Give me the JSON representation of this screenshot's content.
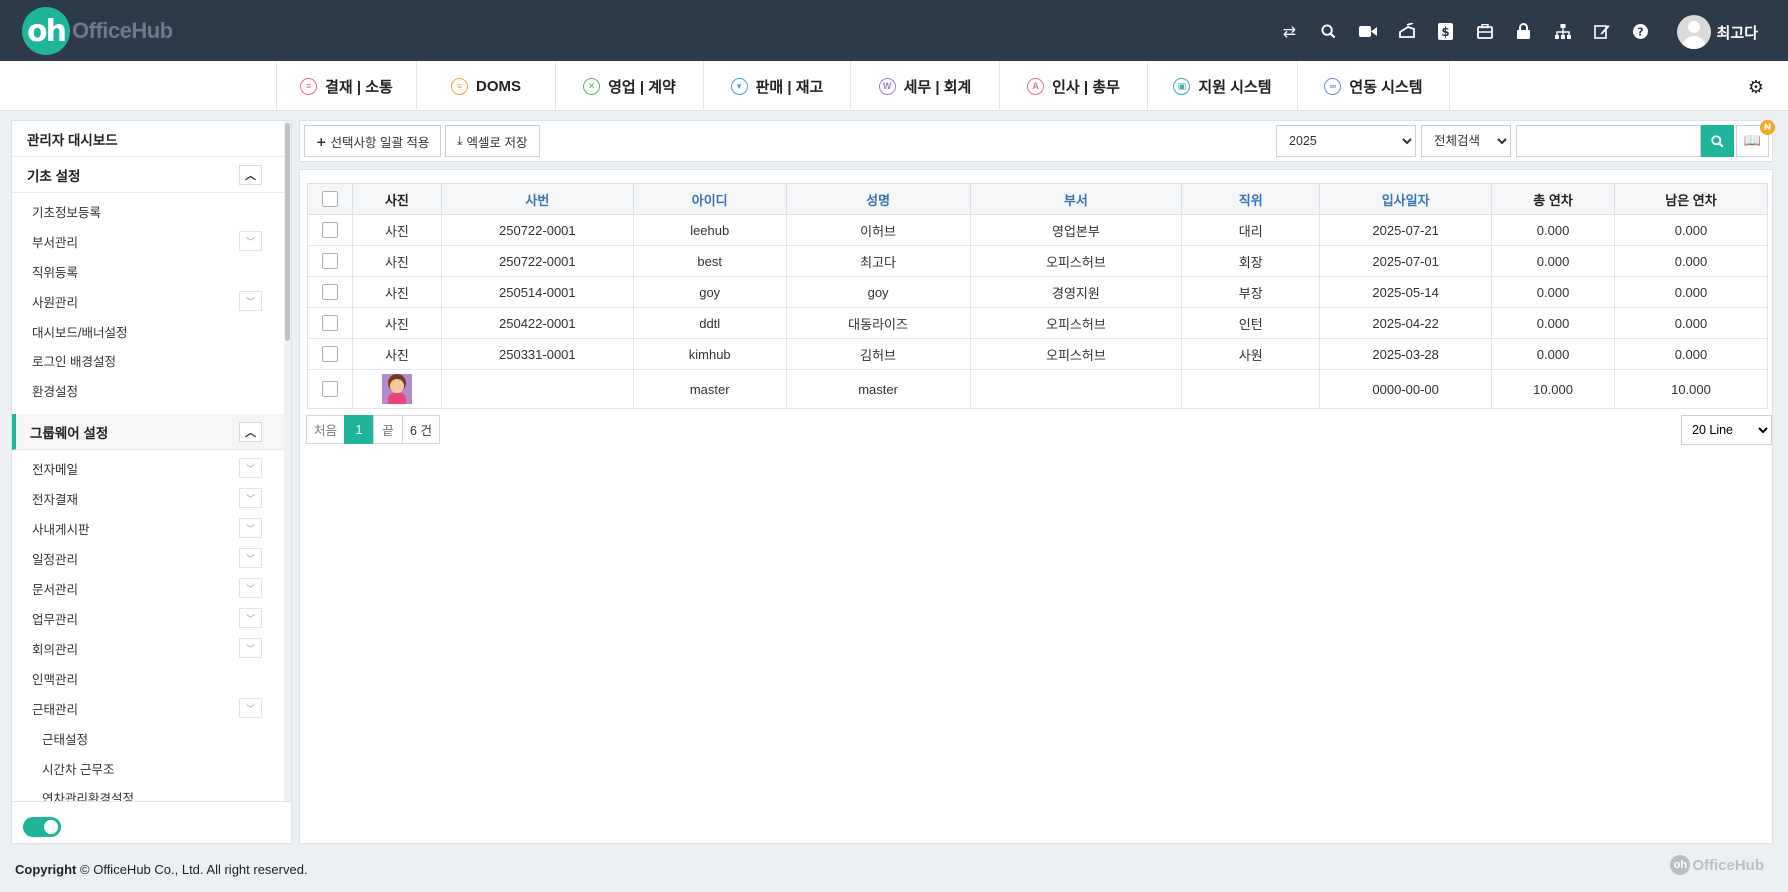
{
  "brand": {
    "mark": "oh",
    "name": "OfficeHub"
  },
  "top_icons": [
    "swap-icon",
    "search-icon",
    "video-icon",
    "fax-icon",
    "dollar-icon",
    "briefcase-icon",
    "lock-icon",
    "sitemap-icon",
    "edit-icon",
    "help-icon"
  ],
  "user": {
    "name": "최고다"
  },
  "nav": [
    {
      "label": "결재 | 소통",
      "icon": "approval-icon",
      "color": "#e86a7a"
    },
    {
      "label": "DOMS",
      "icon": "doms-icon",
      "color": "#f0a24a"
    },
    {
      "label": "영업 | 계약",
      "icon": "sales-icon",
      "color": "#5cb85c"
    },
    {
      "label": "판매 | 재고",
      "icon": "cart-icon",
      "color": "#4a9fd8"
    },
    {
      "label": "세무 | 회계",
      "icon": "won-icon",
      "color": "#9b7fd1"
    },
    {
      "label": "인사 | 총무",
      "icon": "hr-icon",
      "color": "#e86aa0"
    },
    {
      "label": "지원 시스템",
      "icon": "support-icon",
      "color": "#3ab0b0"
    },
    {
      "label": "연동 시스템",
      "icon": "link-icon",
      "color": "#6a8ad8"
    }
  ],
  "sidebar": {
    "dashboard": "관리자 대시보드",
    "basic_title": "기초 설정",
    "basic_items": [
      {
        "label": "기초정보등록",
        "expand": false
      },
      {
        "label": "부서관리",
        "expand": true
      },
      {
        "label": "직위등록",
        "expand": false
      },
      {
        "label": "사원관리",
        "expand": true
      },
      {
        "label": "대시보드/배너설정",
        "expand": false
      },
      {
        "label": "로그인 배경설정",
        "expand": false
      },
      {
        "label": "환경설정",
        "expand": false
      }
    ],
    "groupware_title": "그룹웨어 설정",
    "groupware_items": [
      {
        "label": "전자메일",
        "expand": true
      },
      {
        "label": "전자결재",
        "expand": true
      },
      {
        "label": "사내게시판",
        "expand": true
      },
      {
        "label": "일정관리",
        "expand": true
      },
      {
        "label": "문서관리",
        "expand": true
      },
      {
        "label": "업무관리",
        "expand": true
      },
      {
        "label": "회의관리",
        "expand": true
      },
      {
        "label": "인맥관리",
        "expand": false
      },
      {
        "label": "근태관리",
        "expand": true
      }
    ],
    "sub_items": [
      "근태설정",
      "시간차 근무조",
      "연차관리환경설정"
    ]
  },
  "toolbar": {
    "apply_label": "선택사항 일괄 적용",
    "excel_label": "엑셀로 저장",
    "year_value": "2025",
    "search_scope": "전체검색",
    "search_value": "",
    "badge": "N"
  },
  "table": {
    "headers": [
      "사진",
      "사번",
      "아이디",
      "성명",
      "부서",
      "직위",
      "입사일자",
      "총 연차",
      "남은 연차"
    ],
    "rows": [
      {
        "photo": "사진",
        "emp_no": "250722-0001",
        "id": "leehub",
        "name": "이허브",
        "dept": "영업본부",
        "position": "대리",
        "hire_date": "2025-07-21",
        "total_leave": "0.000",
        "remaining_leave": "0.000"
      },
      {
        "photo": "사진",
        "emp_no": "250722-0001",
        "id": "best",
        "name": "최고다",
        "dept": "오피스허브",
        "position": "회장",
        "hire_date": "2025-07-01",
        "total_leave": "0.000",
        "remaining_leave": "0.000"
      },
      {
        "photo": "사진",
        "emp_no": "250514-0001",
        "id": "goy",
        "name": "goy",
        "dept": "경영지원",
        "position": "부장",
        "hire_date": "2025-05-14",
        "total_leave": "0.000",
        "remaining_leave": "0.000"
      },
      {
        "photo": "사진",
        "emp_no": "250422-0001",
        "id": "ddtl",
        "name": "대동라이즈",
        "dept": "오피스허브",
        "position": "인턴",
        "hire_date": "2025-04-22",
        "total_leave": "0.000",
        "remaining_leave": "0.000"
      },
      {
        "photo": "사진",
        "emp_no": "250331-0001",
        "id": "kimhub",
        "name": "김허브",
        "dept": "오피스허브",
        "position": "사원",
        "hire_date": "2025-03-28",
        "total_leave": "0.000",
        "remaining_leave": "0.000"
      },
      {
        "photo": "",
        "emp_no": "",
        "id": "master",
        "name": "master",
        "dept": "",
        "position": "",
        "hire_date": "0000-00-00",
        "total_leave": "10.000",
        "remaining_leave": "10.000"
      }
    ]
  },
  "pager": {
    "first": "처음",
    "current": "1",
    "last": "끝",
    "count": "6 건",
    "lines": "20 Line"
  },
  "footer": {
    "copyright_label": "Copyright",
    "copyright_text": "© OfficeHub Co., Ltd. All right reserved.",
    "logo_mark": "oh",
    "logo_text": "OfficeHub"
  },
  "colors": {
    "accent": "#1fb59a",
    "topbar": "#2c3a4a",
    "link": "#3a74b5"
  }
}
